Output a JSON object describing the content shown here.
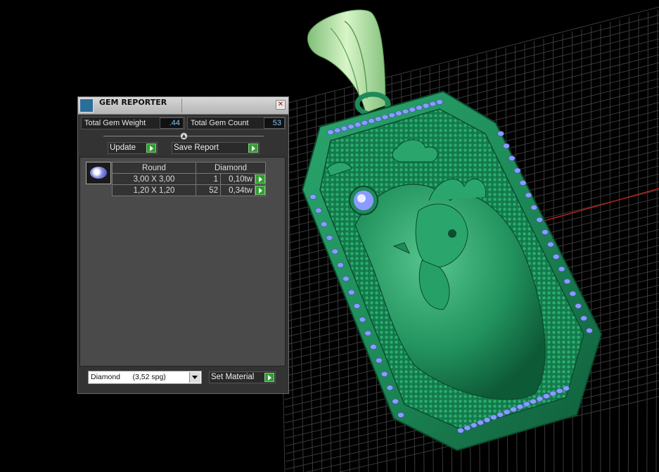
{
  "panel": {
    "title": "GEM REPORTER",
    "close_glyph": "✕",
    "total_weight_label": "Total Gem Weight",
    "total_weight_value": ".44",
    "total_count_label": "Total Gem Count",
    "total_count_value": "53",
    "update_label": "Update",
    "save_report_label": "Save Report",
    "table": {
      "header_shape": "Round",
      "header_material": "Diamond",
      "rows": [
        {
          "size": "3,00 X 3,00",
          "count": "1",
          "tw": "0,10tw"
        },
        {
          "size": "1,20 X 1,20",
          "count": "52",
          "tw": "0,34tw"
        }
      ]
    },
    "material_select": "Diamond      (3,52 spg)",
    "set_material_label": "Set Material"
  },
  "colors": {
    "metal": "#1f8a5c",
    "metal_highlight": "#7fe0a8",
    "bail": "#a8e6a0",
    "gem": "#8a9cff",
    "grid": "#3a3a3a",
    "x_axis": "#b52020"
  },
  "icons": {
    "title_icon": "gem-reporter-icon",
    "thumb": "round-diamond-icon"
  }
}
